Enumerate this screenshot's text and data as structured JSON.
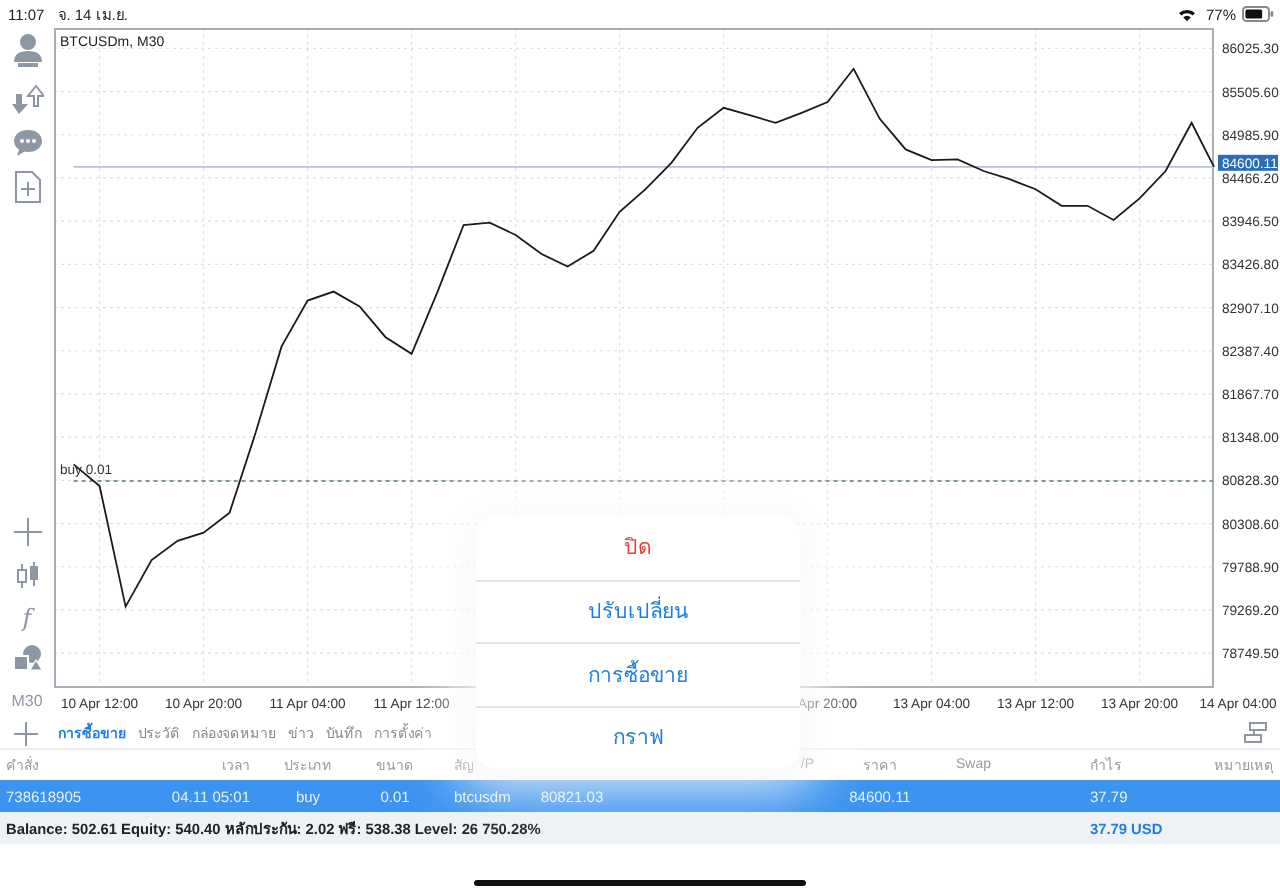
{
  "status_bar": {
    "time": "11:07",
    "date": "จ. 14 เม.ย.",
    "battery": "77%"
  },
  "toolbar": {
    "function_label": "f",
    "timeframe": "M30"
  },
  "chart": {
    "chart_data": {
      "type": "line",
      "title": "BTCUSDm, M30",
      "categories": [
        null,
        "10 Apr 12:00",
        null,
        null,
        null,
        "10 Apr 20:00",
        null,
        null,
        null,
        "11 Apr 04:00",
        null,
        null,
        null,
        "11 Apr 12:00",
        null,
        null,
        null,
        null,
        null,
        null,
        null,
        null,
        null,
        null,
        null,
        null,
        null,
        null,
        null,
        "Apr 20:00",
        null,
        null,
        null,
        "13 Apr 04:00",
        null,
        null,
        null,
        "13 Apr 12:00",
        null,
        null,
        null,
        "13 Apr 20:00",
        null,
        null,
        null,
        "14 Apr 04:00"
      ],
      "series": [
        {
          "color": "#1a1a1a",
          "values": [
            81020,
            80760,
            79310,
            79870,
            80100,
            80200,
            80440,
            81400,
            82440,
            82990,
            83100,
            82920,
            82550,
            82350,
            83100,
            83900,
            83930,
            83780,
            83550,
            83400,
            83590,
            84060,
            84330,
            84650,
            85070,
            85310,
            85220,
            85130,
            85250,
            85380,
            85780,
            85180,
            84810,
            84680,
            84690,
            84550,
            84450,
            84330,
            84130,
            84130,
            83960,
            84220,
            84550,
            85130,
            84600,
            null
          ]
        },
        {
          "color": "#b6c2d3",
          "values": [
            84600,
            84600,
            84600,
            84600,
            84600,
            84600,
            84600,
            84600,
            84600,
            84600,
            84600,
            84600,
            84600,
            84600,
            84600,
            84600,
            84600,
            84600,
            84600,
            84600,
            84600,
            84600,
            84600,
            84600,
            84600,
            84600,
            84600,
            84600,
            84600,
            84600,
            84600,
            84600,
            84600,
            84600,
            84600,
            84600,
            84600,
            84600,
            84600,
            84600,
            84600,
            84600,
            84600,
            84600,
            84600,
            null
          ]
        },
        {
          "color": "#7e9a86",
          "line_style": "dashed",
          "values": [
            80820,
            80820,
            80820,
            80820,
            80820,
            80820,
            80820,
            80820,
            80820,
            80820,
            80820,
            80820,
            80820,
            80820,
            80820,
            80820,
            80820,
            80820,
            80820,
            80820,
            80820,
            80820,
            80820,
            80820,
            80820,
            80820,
            80820,
            80820,
            80820,
            80820,
            80820,
            80820,
            80820,
            80820,
            80820,
            80820,
            80820,
            80820,
            80820,
            80820,
            80820,
            80820,
            80820,
            80820,
            80820,
            null
          ]
        }
      ],
      "grid": true,
      "ylim": [
        78330,
        86270
      ],
      "yticks": [
        {
          "value": 86025.3,
          "label": "86025.30"
        },
        {
          "value": 85505.6,
          "label": "85505.60"
        },
        {
          "value": 84985.9,
          "label": "84985.90"
        },
        {
          "value": 84466.2,
          "label": "84466.20"
        },
        {
          "value": 83946.5,
          "label": "83946.50"
        },
        {
          "value": 83426.8,
          "label": "83426.80"
        },
        {
          "value": 82907.1,
          "label": "82907.10"
        },
        {
          "value": 82387.4,
          "label": "82387.40"
        },
        {
          "value": 81867.7,
          "label": "81867.70"
        },
        {
          "value": 81348,
          "label": "81348.00"
        },
        {
          "value": 80828.3,
          "label": "80828.30"
        },
        {
          "value": 80308.6,
          "label": "80308.60"
        },
        {
          "value": 79788.9,
          "label": "79788.90"
        },
        {
          "value": 79269.2,
          "label": "79269.20"
        },
        {
          "value": 78749.5,
          "label": "78749.50"
        }
      ],
      "annotations": [
        "84600.11",
        "buy 0.01"
      ]
    }
  },
  "tabs": [
    {
      "label": "การซื้อขาย",
      "selected": true
    },
    {
      "label": "ประวัติ",
      "selected": false
    },
    {
      "label": "กล่องจดหมาย",
      "selected": false
    },
    {
      "label": "ข่าว",
      "selected": false
    },
    {
      "label": "บันทึก",
      "selected": false
    },
    {
      "label": "การตั้งค่า",
      "selected": false
    }
  ],
  "table": {
    "columns": [
      {
        "kind": "order",
        "label": "คำสั่ง"
      },
      {
        "kind": "time",
        "label": "เวลา"
      },
      {
        "kind": "type",
        "label": "ประเภท"
      },
      {
        "kind": "volume",
        "label": "ขนาด"
      },
      {
        "kind": "symbol",
        "label": "สัญ"
      },
      {
        "kind": "open_price"
      },
      {
        "kind": "sl"
      },
      {
        "kind": "tp",
        "label": "/P"
      },
      {
        "kind": "price",
        "label": "ราคา"
      },
      {
        "kind": "swap",
        "label": "Swap"
      },
      {
        "kind": "profit",
        "label": "กำไร"
      },
      {
        "kind": "comment",
        "label": "หมายเหตุ"
      }
    ],
    "rows": [
      {
        "selected": true,
        "cells": [
          "738618905",
          "04.11 05:01",
          "buy",
          "0.01",
          "btcusdm",
          "80821.03",
          "",
          "",
          "84600.11",
          "",
          "37.79",
          ""
        ]
      }
    ]
  },
  "summary": {
    "text": "Balance: 502.61 Equity: 540.40 หลักประกัน: 2.02 ฟรี: 538.38 Level: 26 750.28%",
    "profit": "37.79  USD"
  },
  "popup_menu": {
    "items": [
      {
        "kind": "destructive",
        "label": "ปิด"
      },
      {
        "kind": "action",
        "label": "ปรับเปลี่ยน"
      },
      {
        "kind": "action",
        "label": "การซื้อขาย"
      },
      {
        "kind": "action",
        "label": "กราฟ"
      }
    ]
  }
}
